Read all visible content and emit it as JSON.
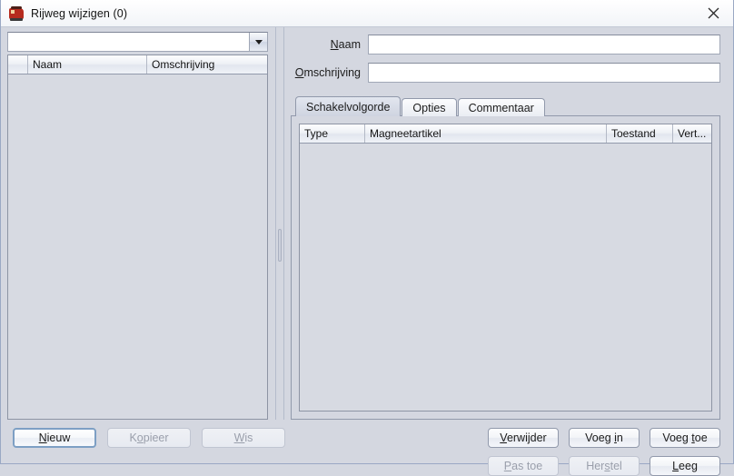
{
  "window": {
    "title": "Rijweg wijzigen (0)",
    "icon": "locomotive-icon",
    "close_label": "×",
    "background_color": "#d4d7e0",
    "accent_color": "#7d9fc4"
  },
  "left_panel": {
    "combo": {
      "value": "",
      "placeholder": "",
      "arrow": "chevron-down-icon"
    },
    "table": {
      "columns": [
        "",
        "Naam",
        "Omschrijving"
      ],
      "rows": []
    },
    "buttons": [
      {
        "label": "Nieuw",
        "mnemonic": "N",
        "enabled": true,
        "focused": true
      },
      {
        "label": "Kopieer",
        "mnemonic": "o",
        "enabled": false,
        "focused": false
      },
      {
        "label": "Wis",
        "mnemonic": "W",
        "enabled": false,
        "focused": false
      }
    ]
  },
  "right_panel": {
    "fields": [
      {
        "label": "Naam",
        "mnemonic": "N",
        "value": "",
        "placeholder": ""
      },
      {
        "label": "Omschrijving",
        "mnemonic": "O",
        "value": "",
        "placeholder": ""
      }
    ],
    "tabs": [
      {
        "label": "Schakelvolgorde",
        "active": true
      },
      {
        "label": "Opties",
        "active": false
      },
      {
        "label": "Commentaar",
        "active": false
      }
    ],
    "table": {
      "columns": [
        "Type",
        "Magneetartikel",
        "Toestand",
        "Vert..."
      ],
      "rows": []
    },
    "buttons_row1": [
      {
        "label": "Verwijder",
        "mnemonic": "V",
        "enabled": true
      },
      {
        "label": "Voeg in",
        "mnemonic": "i",
        "enabled": true
      },
      {
        "label": "Voeg toe",
        "mnemonic": "t",
        "enabled": true
      }
    ],
    "buttons_row2": [
      {
        "label": "Pas toe",
        "mnemonic": "P",
        "enabled": false
      },
      {
        "label": "Herstel",
        "mnemonic": "s",
        "enabled": false
      },
      {
        "label": "Leeg",
        "mnemonic": "L",
        "enabled": true
      }
    ]
  }
}
